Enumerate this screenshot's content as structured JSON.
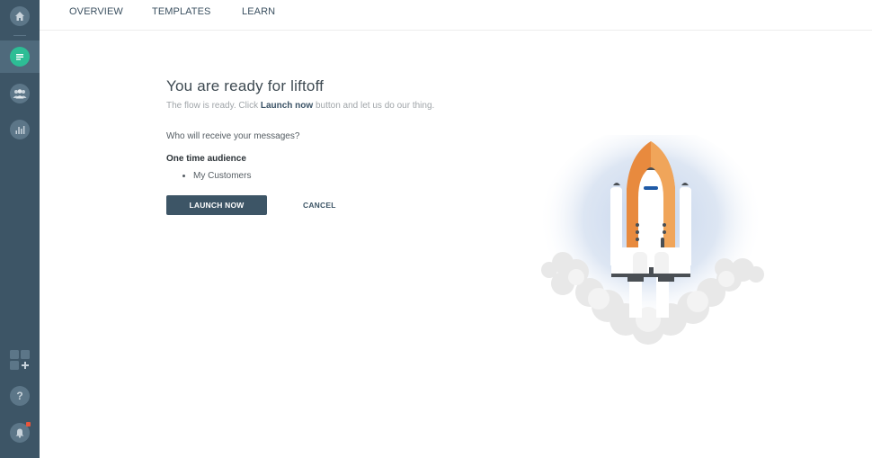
{
  "sidebar": {
    "items": [
      {
        "name": "home",
        "icon": "home-icon",
        "active": false
      },
      {
        "name": "messages",
        "icon": "chat-icon",
        "active": true
      },
      {
        "name": "audience",
        "icon": "people-icon",
        "active": false
      },
      {
        "name": "analytics",
        "icon": "bar-chart-icon",
        "active": false
      }
    ],
    "bottom": [
      {
        "name": "add-app",
        "icon": "add-grid-icon"
      },
      {
        "name": "help",
        "icon": "help-icon",
        "glyph": "?"
      },
      {
        "name": "notifications",
        "icon": "bell-icon",
        "has_badge": true
      }
    ],
    "colors": {
      "background": "#3d5566",
      "active_icon": "#2dbd95",
      "badge": "#e8553b"
    }
  },
  "topnav": {
    "tabs": [
      {
        "label": "OVERVIEW"
      },
      {
        "label": "TEMPLATES"
      },
      {
        "label": "LEARN"
      }
    ]
  },
  "main": {
    "title": "You are ready for liftoff",
    "subtitle_pre": "The flow is ready. Click ",
    "subtitle_bold": "Launch now",
    "subtitle_post": " button and let us do our thing.",
    "question": "Who will receive your messages?",
    "audience_title": "One time audience",
    "audience_items": [
      "My Customers"
    ],
    "launch_label": "LAUNCH NOW",
    "cancel_label": "CANCEL"
  },
  "illustration": {
    "name": "rocket-launch",
    "colors": {
      "orange": "#e88a3e",
      "orange_light": "#f0a55a",
      "white": "#ffffff",
      "dark": "#4a4f54",
      "blue": "#1f5aa6",
      "glow": "#cfdcef",
      "cloud": "#e6e6e6"
    }
  }
}
